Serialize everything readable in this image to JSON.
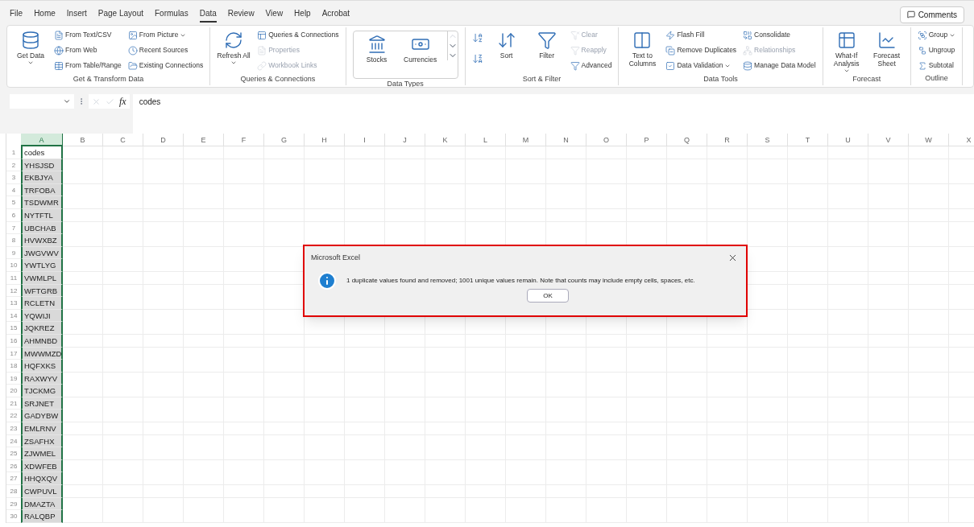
{
  "menu": {
    "tabs": [
      {
        "label": "File",
        "selected": false
      },
      {
        "label": "Home",
        "selected": false
      },
      {
        "label": "Insert",
        "selected": false
      },
      {
        "label": "Page Layout",
        "selected": false
      },
      {
        "label": "Formulas",
        "selected": false
      },
      {
        "label": "Data",
        "selected": true
      },
      {
        "label": "Review",
        "selected": false
      },
      {
        "label": "View",
        "selected": false
      },
      {
        "label": "Help",
        "selected": false
      },
      {
        "label": "Acrobat",
        "selected": false
      }
    ],
    "comments_button": "Comments"
  },
  "ribbon": {
    "groups": [
      {
        "label": "Get & Transform Data",
        "kind": "buttons",
        "columns": [
          [
            {
              "label": "Get Data",
              "kind": "large",
              "disabled": false,
              "dropdown": true
            }
          ],
          [
            {
              "label": "From Text/CSV",
              "kind": "small",
              "disabled": false,
              "dropdown": false
            },
            {
              "label": "From Web",
              "kind": "small",
              "disabled": false,
              "dropdown": false
            },
            {
              "label": "From Table/Range",
              "kind": "small",
              "disabled": false,
              "dropdown": false
            }
          ],
          [
            {
              "label": "From Picture",
              "kind": "small",
              "disabled": false,
              "dropdown": true
            },
            {
              "label": "Recent Sources",
              "kind": "small",
              "disabled": false,
              "dropdown": false
            },
            {
              "label": "Existing Connections",
              "kind": "small",
              "disabled": false,
              "dropdown": false
            }
          ]
        ]
      },
      {
        "label": "Queries & Connections",
        "kind": "buttons",
        "columns": [
          [
            {
              "label": "Refresh All",
              "kind": "large",
              "disabled": false,
              "dropdown": true
            }
          ],
          [
            {
              "label": "Queries & Connections",
              "kind": "small",
              "disabled": false,
              "dropdown": false
            },
            {
              "label": "Properties",
              "kind": "small",
              "disabled": true,
              "dropdown": false
            },
            {
              "label": "Workbook Links",
              "kind": "small",
              "disabled": true,
              "dropdown": false
            }
          ]
        ]
      },
      {
        "label": "Data Types",
        "kind": "gallery",
        "columns": [
          [
            {
              "label": "Stocks",
              "kind": "large",
              "disabled": false,
              "dropdown": false
            }
          ],
          [
            {
              "label": "Currencies",
              "kind": "large",
              "disabled": false,
              "dropdown": false
            }
          ]
        ]
      },
      {
        "label": "Sort & Filter",
        "kind": "buttons",
        "columns": [
          [
            {
              "kind": "icon",
              "disabled": false,
              "dropdown": false
            },
            {
              "kind": "icon",
              "disabled": false,
              "dropdown": false
            }
          ],
          [
            {
              "label": "Sort",
              "kind": "large",
              "disabled": false,
              "dropdown": false
            }
          ],
          [
            {
              "label": "Filter",
              "kind": "large",
              "disabled": false,
              "dropdown": false
            }
          ],
          [
            {
              "label": "Clear",
              "kind": "small",
              "disabled": true,
              "dropdown": false
            },
            {
              "label": "Reapply",
              "kind": "small",
              "disabled": true,
              "dropdown": false
            },
            {
              "label": "Advanced",
              "kind": "small",
              "disabled": false,
              "dropdown": false
            }
          ]
        ]
      },
      {
        "label": "Data Tools",
        "kind": "buttons",
        "columns": [
          [
            {
              "label": "Text to Columns",
              "kind": "large",
              "disabled": false,
              "dropdown": false
            }
          ],
          [
            {
              "label": "Flash Fill",
              "kind": "small",
              "disabled": false,
              "dropdown": false
            },
            {
              "label": "Remove Duplicates",
              "kind": "small",
              "disabled": false,
              "dropdown": false
            },
            {
              "label": "Data Validation",
              "kind": "small",
              "disabled": false,
              "dropdown": true
            }
          ],
          [
            {
              "label": "Consolidate",
              "kind": "small",
              "disabled": false,
              "dropdown": false
            },
            {
              "label": "Relationships",
              "kind": "small",
              "disabled": true,
              "dropdown": false
            },
            {
              "label": "Manage Data Model",
              "kind": "small",
              "disabled": false,
              "dropdown": false
            }
          ]
        ]
      },
      {
        "label": "Forecast",
        "kind": "buttons",
        "columns": [
          [
            {
              "label": "What-If Analysis",
              "kind": "large",
              "disabled": false,
              "dropdown": true
            }
          ],
          [
            {
              "label": "Forecast Sheet",
              "kind": "large",
              "disabled": false,
              "dropdown": false
            }
          ]
        ]
      },
      {
        "label": "Outline",
        "kind": "buttons",
        "columns": [
          [
            {
              "label": "Group",
              "kind": "small",
              "disabled": false,
              "dropdown": true
            },
            {
              "label": "Ungroup",
              "kind": "small",
              "disabled": false,
              "dropdown": false
            },
            {
              "label": "Subtotal",
              "kind": "small",
              "disabled": false,
              "dropdown": false
            }
          ]
        ]
      }
    ]
  },
  "formula_bar": {
    "fx_label": "fx",
    "value": "codes"
  },
  "grid": {
    "columns": [
      {
        "label": "A",
        "selected": true
      },
      {
        "label": "B",
        "selected": false
      },
      {
        "label": "C",
        "selected": false
      },
      {
        "label": "D",
        "selected": false
      },
      {
        "label": "E",
        "selected": false
      },
      {
        "label": "F",
        "selected": false
      },
      {
        "label": "G",
        "selected": false
      },
      {
        "label": "H",
        "selected": false
      },
      {
        "label": "I",
        "selected": false
      },
      {
        "label": "J",
        "selected": false
      },
      {
        "label": "K",
        "selected": false
      },
      {
        "label": "L",
        "selected": false
      },
      {
        "label": "M",
        "selected": false
      },
      {
        "label": "N",
        "selected": false
      },
      {
        "label": "O",
        "selected": false
      },
      {
        "label": "P",
        "selected": false
      },
      {
        "label": "Q",
        "selected": false
      },
      {
        "label": "R",
        "selected": false
      },
      {
        "label": "S",
        "selected": false
      },
      {
        "label": "T",
        "selected": false
      },
      {
        "label": "U",
        "selected": false
      },
      {
        "label": "V",
        "selected": false
      },
      {
        "label": "W",
        "selected": false
      },
      {
        "label": "X",
        "selected": false
      }
    ],
    "rows": [
      {
        "number": "1",
        "value": "codes",
        "active": true
      },
      {
        "number": "2",
        "value": "YHSJSD",
        "active": false
      },
      {
        "number": "3",
        "value": "EKBJYA",
        "active": false
      },
      {
        "number": "4",
        "value": "TRFOBA",
        "active": false
      },
      {
        "number": "5",
        "value": "TSDWMR",
        "active": false
      },
      {
        "number": "6",
        "value": "NYTFTL",
        "active": false
      },
      {
        "number": "7",
        "value": "UBCHAB",
        "active": false
      },
      {
        "number": "8",
        "value": "HVWXBZ",
        "active": false
      },
      {
        "number": "9",
        "value": "JWGVWV",
        "active": false
      },
      {
        "number": "10",
        "value": "YWTLYG",
        "active": false
      },
      {
        "number": "11",
        "value": "VWMLPL",
        "active": false
      },
      {
        "number": "12",
        "value": "WFTGRB",
        "active": false
      },
      {
        "number": "13",
        "value": "RCLETN",
        "active": false
      },
      {
        "number": "14",
        "value": "YQWIJI",
        "active": false
      },
      {
        "number": "15",
        "value": "JQKREZ",
        "active": false
      },
      {
        "number": "16",
        "value": "AHMNBD",
        "active": false
      },
      {
        "number": "17",
        "value": "MWWMZD",
        "active": false
      },
      {
        "number": "18",
        "value": "HQFXKS",
        "active": false
      },
      {
        "number": "19",
        "value": "RAXWYV",
        "active": false
      },
      {
        "number": "20",
        "value": "TJCKMG",
        "active": false
      },
      {
        "number": "21",
        "value": "SRJNET",
        "active": false
      },
      {
        "number": "22",
        "value": "GADYBW",
        "active": false
      },
      {
        "number": "23",
        "value": "EMLRNV",
        "active": false
      },
      {
        "number": "24",
        "value": "ZSAFHX",
        "active": false
      },
      {
        "number": "25",
        "value": "ZJWMEL",
        "active": false
      },
      {
        "number": "26",
        "value": "XDWFEB",
        "active": false
      },
      {
        "number": "27",
        "value": "HHQXQV",
        "active": false
      },
      {
        "number": "28",
        "value": "CWPUVL",
        "active": false
      },
      {
        "number": "29",
        "value": "DMAZTA",
        "active": false
      },
      {
        "number": "30",
        "value": "RALQBP",
        "active": false
      }
    ]
  },
  "dialog": {
    "title": "Microsoft Excel",
    "message": "1 duplicate values found and removed; 1001 unique values remain. Note that counts may include empty cells, spaces, etc.",
    "ok_button": "OK"
  }
}
